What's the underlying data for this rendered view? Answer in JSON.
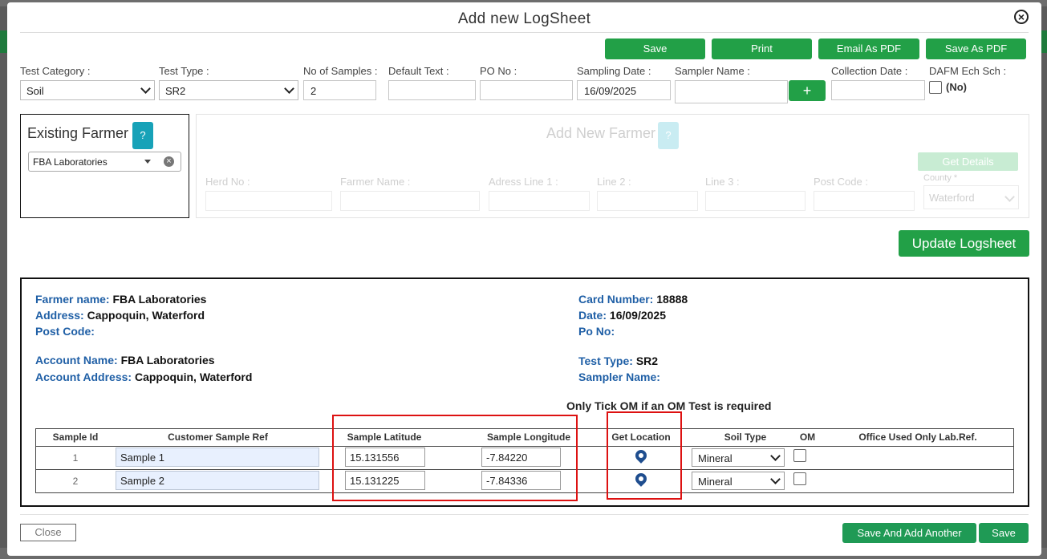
{
  "title": "Add new LogSheet",
  "toolbar": {
    "save": "Save",
    "print": "Print",
    "email_pdf": "Email As PDF",
    "save_pdf": "Save As PDF"
  },
  "form": {
    "test_category": {
      "label": "Test Category :",
      "value": "Soil"
    },
    "test_type": {
      "label": "Test Type :",
      "value": "SR2"
    },
    "no_samples": {
      "label": "No of Samples :",
      "value": "2"
    },
    "default_text": {
      "label": "Default Text :",
      "value": ""
    },
    "po_no": {
      "label": "PO No :",
      "value": ""
    },
    "sampling_date": {
      "label": "Sampling Date :",
      "value": "16/09/2025"
    },
    "sampler_name": {
      "label": "Sampler Name :",
      "value": ""
    },
    "add_sampler": "+",
    "collection_date": {
      "label": "Collection Date :",
      "value": ""
    },
    "dafm": {
      "label": "DAFM Ech Sch :",
      "value": "(No)"
    }
  },
  "existing_farmer": {
    "heading": "Existing Farmer",
    "help": "?",
    "value": "FBA Laboratories"
  },
  "new_farmer": {
    "heading": "Add New Farmer",
    "help": "?",
    "get_details": "Get Details",
    "herd_no": "Herd No :",
    "farmer_name": "Farmer Name :",
    "address1": "Adress Line 1 :",
    "line2": "Line 2 :",
    "line3": "Line 3 :",
    "post_code": "Post Code :",
    "county_label": "County *",
    "county_value": "Waterford"
  },
  "update_btn": "Update Logsheet",
  "info": {
    "farmer_name_label": "Farmer name:",
    "farmer_name": "FBA Laboratories",
    "address_label": "Address:",
    "address": "Cappoquin, Waterford",
    "post_code_label": "Post Code:",
    "post_code": "",
    "account_name_label": "Account Name:",
    "account_name": "FBA Laboratories",
    "account_address_label": "Account Address:",
    "account_address": "Cappoquin, Waterford",
    "card_number_label": "Card Number:",
    "card_number": "18888",
    "date_label": "Date:",
    "date": "16/09/2025",
    "po_label": "Po No:",
    "po": "",
    "test_type_label": "Test Type:",
    "test_type": "SR2",
    "sampler_label": "Sampler Name:",
    "sampler": "",
    "om_note": "Only Tick OM if an OM Test is required"
  },
  "table": {
    "headers": [
      "Sample Id",
      "Customer Sample Ref",
      "Sample Latitude",
      "Sample Longitude",
      "Get Location",
      "Soil Type",
      "OM",
      "Office Used Only Lab.Ref."
    ],
    "rows": [
      {
        "id": "1",
        "ref": "Sample 1",
        "lat": "15.131556",
        "lon": "-7.84220",
        "soil": "Mineral"
      },
      {
        "id": "2",
        "ref": "Sample 2",
        "lat": "15.131225",
        "lon": "-7.84336",
        "soil": "Mineral"
      }
    ]
  },
  "footer": {
    "close": "Close",
    "save_add": "Save And Add Another",
    "save": "Save"
  }
}
